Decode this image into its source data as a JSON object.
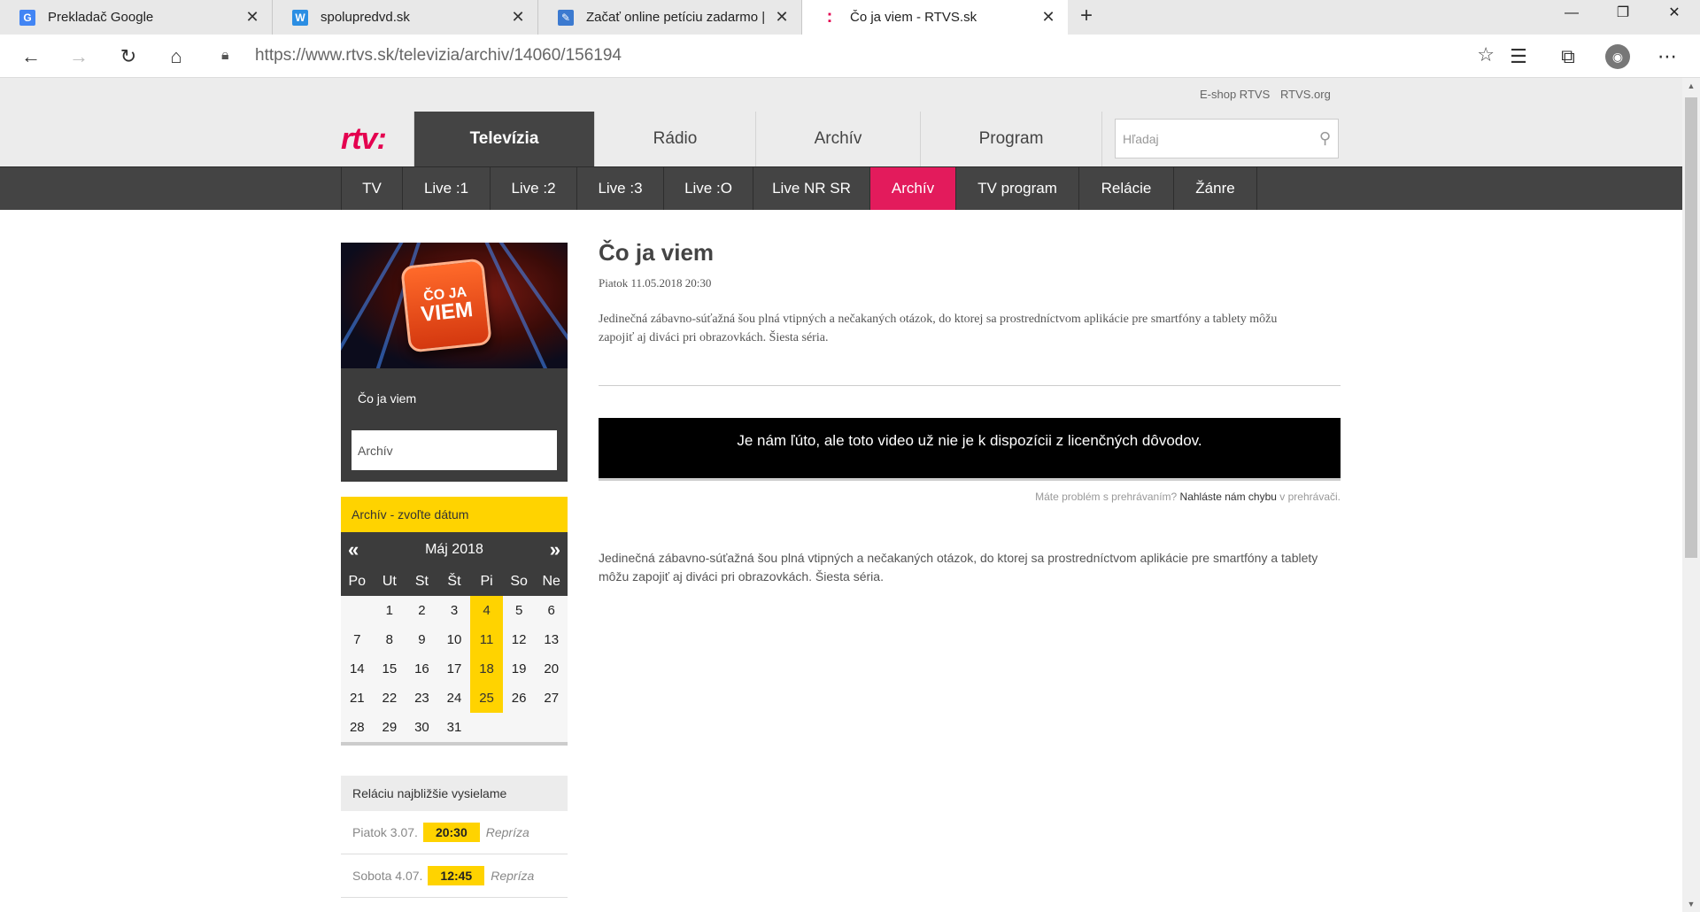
{
  "browser": {
    "tabs": [
      {
        "label": "Prekladač Google",
        "favicon": "google-translate-icon",
        "color": "#4285f4",
        "glyph": "G"
      },
      {
        "label": "spolupredvd.sk",
        "favicon": "w-icon",
        "color": "#2b8ee3",
        "glyph": "W"
      },
      {
        "label": "Začať online petíciu zadarmo | P...",
        "favicon": "petition-icon",
        "color": "#3c7ad0",
        "glyph": "✎"
      },
      {
        "label": "Čo ja viem - RTVS.sk",
        "favicon": "rtvs-icon",
        "color": "#e4004f",
        "glyph": ":"
      }
    ],
    "address_host": "https://www.rtvs.sk",
    "address_path": "/televizia/archiv/14060/156194"
  },
  "site": {
    "util_links": [
      "E-shop RTVS",
      "RTVS.org"
    ],
    "logo": "rtv:",
    "main_tabs": [
      "Televízia",
      "Rádio",
      "Archív",
      "Program"
    ],
    "search_placeholder": "Hľadaj",
    "sub_tabs": [
      "TV",
      "Live :1",
      "Live :2",
      "Live :3",
      "Live :O",
      "Live NR SR",
      "Archív",
      "TV program",
      "Relácie",
      "Žánre"
    ],
    "colors": {
      "accent": "#e31b5c",
      "highlight": "#ffd300",
      "dark": "#444444"
    }
  },
  "sidebar": {
    "show_name": "Čo ja viem",
    "show_select": "Archív",
    "thumbnail_text": [
      "ČO JA",
      "VIEM"
    ],
    "calendar": {
      "title": "Archív - zvoľte dátum",
      "month": "Máj 2018",
      "weekdays": [
        "Po",
        "Ut",
        "St",
        "Št",
        "Pi",
        "So",
        "Ne"
      ],
      "highlighted_days": [
        4,
        11,
        18,
        25
      ],
      "days": [
        "",
        "1",
        "2",
        "3",
        "4",
        "5",
        "6",
        "7",
        "8",
        "9",
        "10",
        "11",
        "12",
        "13",
        "14",
        "15",
        "16",
        "17",
        "18",
        "19",
        "20",
        "21",
        "22",
        "23",
        "24",
        "25",
        "26",
        "27",
        "28",
        "29",
        "30",
        "31",
        "",
        "",
        ""
      ]
    },
    "next_air": {
      "title": "Reláciu najbližšie vysielame",
      "items": [
        {
          "day": "Piatok 3.07.",
          "time": "20:30",
          "note": "Repríza"
        },
        {
          "day": "Sobota 4.07.",
          "time": "12:45",
          "note": "Repríza"
        }
      ]
    }
  },
  "main": {
    "title": "Čo ja viem",
    "date": "Piatok 11.05.2018 20:30",
    "description": "Jedinečná zábavno-súťažná šou plná vtipných a nečakaných otázok, do ktorej sa prostredníctvom aplikácie pre smartfóny a tablety môžu zapojiť aj diváci pri obrazovkách. Šiesta séria.",
    "unavailable": "Je nám ľúto, ale toto video už nie je k dispozícii z licenčných dôvodov.",
    "problem_pre": "Máte problém s prehrávaním?",
    "problem_link": "Nahláste nám chybu",
    "problem_post": "v prehrávači.",
    "description2": "Jedinečná zábavno-súťažná šou plná vtipných a nečakaných otázok, do ktorej sa prostredníctvom aplikácie pre smartfóny a tablety môžu zapojiť aj diváci pri obrazovkách. Šiesta séria."
  }
}
